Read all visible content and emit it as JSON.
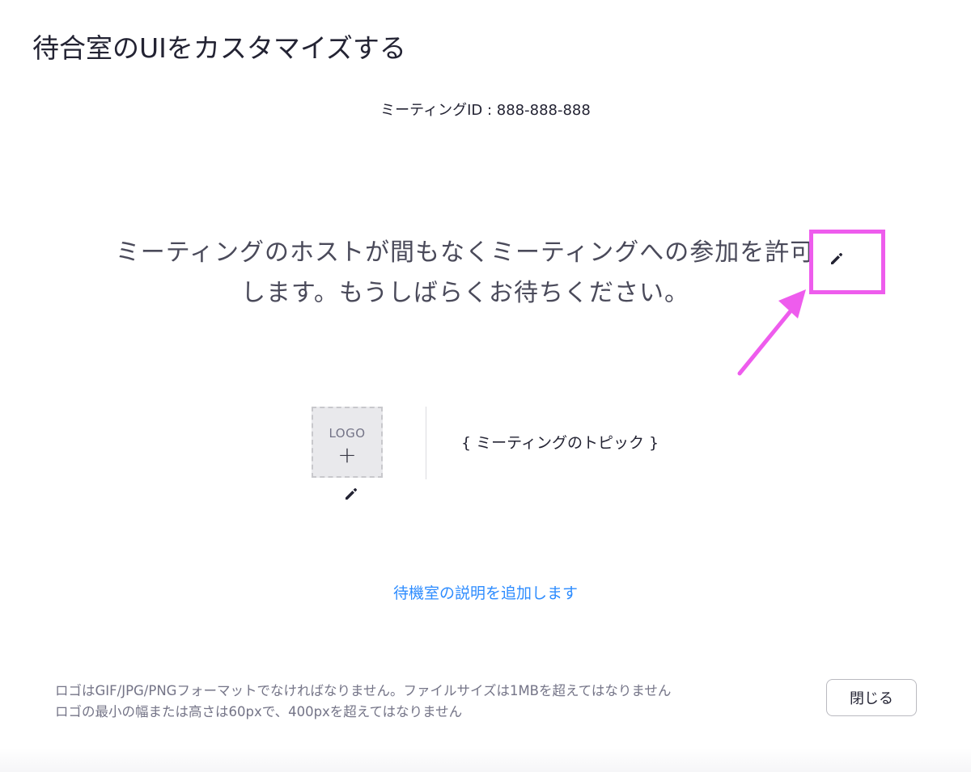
{
  "page": {
    "title": "待合室のUIをカスタマイズする"
  },
  "meeting": {
    "id_label": "ミーティングID : 888-888-888",
    "waiting_message": "ミーティングのホストが間もなくミーティングへの参加を許可します。もうしばらくお待ちください。",
    "topic_placeholder": "{ ミーティングのトピック }"
  },
  "logo": {
    "label": "LOGO",
    "plus_glyph": "+"
  },
  "description": {
    "add_link_label": "待機室の説明を追加します"
  },
  "footer": {
    "note_line1": "ロゴはGIF/JPG/PNGフォーマットでなければなりません。ファイルサイズは1MBを超えてはなりません",
    "note_line2": "ロゴの最小の幅または高さは60pxで、400pxを超えてはなりません",
    "close_label": "閉じる"
  },
  "icons": {
    "message_edit": "pencil-icon",
    "logo_edit": "pencil-icon",
    "annotation": "arrow-icon"
  },
  "colors": {
    "text_primary": "#232333",
    "text_secondary": "#747487",
    "link": "#2d8cff",
    "annotation": "#ee5ced"
  }
}
